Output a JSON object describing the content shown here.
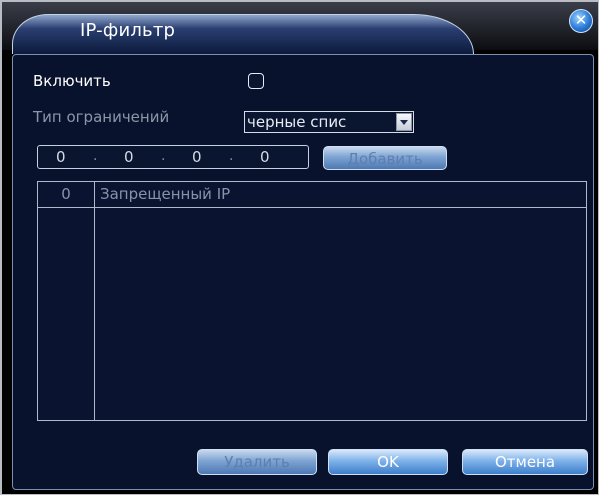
{
  "window": {
    "title": "IP-фильтр",
    "close_icon": "close-icon"
  },
  "enable": {
    "label": "Включить",
    "checked": false
  },
  "restriction": {
    "label": "Тип ограничений",
    "value": "черные спис"
  },
  "ip_input": {
    "octets": [
      "0",
      "0",
      "0",
      "0"
    ]
  },
  "add_button": {
    "label": "Добавить",
    "enabled": false
  },
  "table": {
    "columns": [
      "0",
      "Запрещенный IP"
    ],
    "rows": []
  },
  "buttons": {
    "delete": "Удалить",
    "ok": "OK",
    "cancel": "Отмена"
  },
  "colors": {
    "panel_bg": "#09122c",
    "button_blue": "#3e7fcd",
    "border": "#aeb9cc"
  }
}
